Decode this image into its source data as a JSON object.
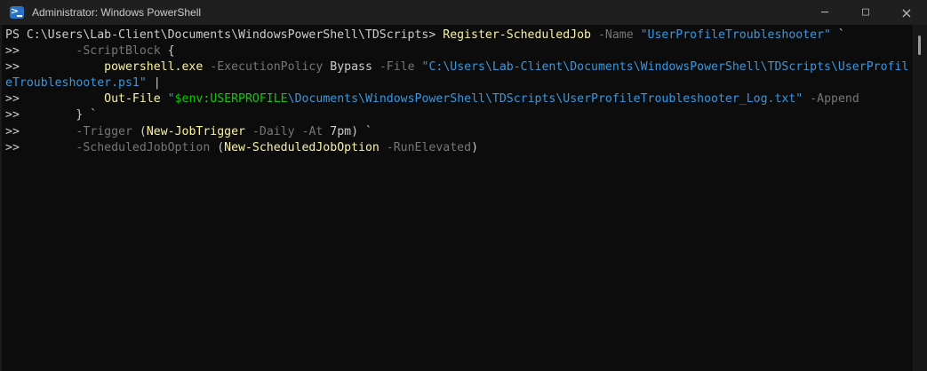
{
  "window": {
    "title": "Administrator: Windows PowerShell",
    "icons": {
      "app": "powershell-icon",
      "minimize": "─",
      "maximize": "□",
      "close": "×"
    }
  },
  "terminal": {
    "colors": {
      "plain": "#cccccc",
      "command": "#f9f1a5",
      "parameter": "#767676",
      "string": "#3a96dd",
      "variable": "#16c60c"
    },
    "lines": [
      {
        "segments": [
          [
            "plain",
            "PS C:\\Users\\Lab-Client\\Documents\\WindowsPowerShell\\TDScripts> "
          ],
          [
            "command",
            "Register-ScheduledJob"
          ],
          [
            "plain",
            " "
          ],
          [
            "parameter",
            "-Name"
          ],
          [
            "plain",
            " "
          ],
          [
            "string",
            "\"UserProfileTroubleshooter\""
          ],
          [
            "plain",
            " `"
          ]
        ]
      },
      {
        "segments": [
          [
            "plain",
            ">>        "
          ],
          [
            "parameter",
            "-ScriptBlock"
          ],
          [
            "plain",
            " {"
          ]
        ]
      },
      {
        "segments": [
          [
            "plain",
            ">>            "
          ],
          [
            "command",
            "powershell.exe"
          ],
          [
            "plain",
            " "
          ],
          [
            "parameter",
            "-ExecutionPolicy"
          ],
          [
            "plain",
            " Bypass "
          ],
          [
            "parameter",
            "-File"
          ],
          [
            "plain",
            " "
          ],
          [
            "string",
            "\"C:\\Users\\Lab-Client\\Documents\\WindowsPowerShell\\TDScripts\\UserProfil"
          ]
        ]
      },
      {
        "segments": [
          [
            "string",
            "eTroubleshooter.ps1\""
          ],
          [
            "plain",
            " |"
          ]
        ]
      },
      {
        "segments": [
          [
            "plain",
            ">>            "
          ],
          [
            "command",
            "Out-File"
          ],
          [
            "plain",
            " "
          ],
          [
            "string",
            "\""
          ],
          [
            "variable",
            "$env:USERPROFILE"
          ],
          [
            "string",
            "\\Documents\\WindowsPowerShell\\TDScripts\\UserProfileTroubleshooter_Log.txt\""
          ],
          [
            "plain",
            " "
          ],
          [
            "parameter",
            "-Append"
          ]
        ]
      },
      {
        "segments": [
          [
            "plain",
            ">>        } `"
          ]
        ]
      },
      {
        "segments": [
          [
            "plain",
            ">>        "
          ],
          [
            "parameter",
            "-Trigger"
          ],
          [
            "plain",
            " ("
          ],
          [
            "command",
            "New-JobTrigger"
          ],
          [
            "plain",
            " "
          ],
          [
            "parameter",
            "-Daily"
          ],
          [
            "plain",
            " "
          ],
          [
            "parameter",
            "-At"
          ],
          [
            "plain",
            " 7pm) `"
          ]
        ]
      },
      {
        "segments": [
          [
            "plain",
            ">>        "
          ],
          [
            "parameter",
            "-ScheduledJobOption"
          ],
          [
            "plain",
            " ("
          ],
          [
            "command",
            "New-ScheduledJobOption"
          ],
          [
            "plain",
            " "
          ],
          [
            "parameter",
            "-RunElevated"
          ],
          [
            "plain",
            ")"
          ]
        ]
      }
    ]
  }
}
